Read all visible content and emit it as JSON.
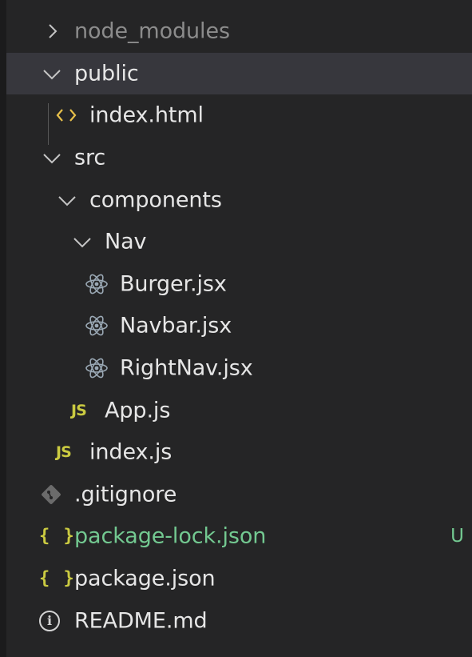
{
  "explorer": {
    "items": [
      {
        "label": "node_modules",
        "icon": "chevron-right-icon",
        "kind": "folder",
        "state": "collapsed"
      },
      {
        "label": "public",
        "icon": "chevron-down-icon",
        "kind": "folder",
        "state": "expanded",
        "selected": true
      },
      {
        "label": "index.html",
        "icon": "html-code-icon",
        "kind": "file"
      },
      {
        "label": "src",
        "icon": "chevron-down-icon",
        "kind": "folder",
        "state": "expanded"
      },
      {
        "label": "components",
        "icon": "chevron-down-icon",
        "kind": "folder",
        "state": "expanded"
      },
      {
        "label": "Nav",
        "icon": "chevron-down-icon",
        "kind": "folder",
        "state": "expanded"
      },
      {
        "label": "Burger.jsx",
        "icon": "react-icon",
        "kind": "file"
      },
      {
        "label": "Navbar.jsx",
        "icon": "react-icon",
        "kind": "file"
      },
      {
        "label": "RightNav.jsx",
        "icon": "react-icon",
        "kind": "file"
      },
      {
        "label": "App.js",
        "icon": "js-icon",
        "icon_text": "JS",
        "kind": "file"
      },
      {
        "label": "index.js",
        "icon": "js-icon",
        "icon_text": "JS",
        "kind": "file"
      },
      {
        "label": ".gitignore",
        "icon": "git-icon",
        "kind": "file"
      },
      {
        "label": "package-lock.json",
        "icon": "json-icon",
        "icon_text": "{ }",
        "kind": "file",
        "git_status": "U"
      },
      {
        "label": "package.json",
        "icon": "json-icon",
        "icon_text": "{ }",
        "kind": "file"
      },
      {
        "label": "README.md",
        "icon": "info-icon",
        "icon_text": "i",
        "kind": "file"
      }
    ]
  },
  "colors": {
    "background": "#252526",
    "selected_row": "#37373d",
    "text": "#e6e6e6",
    "dim_text": "#8c8c8c",
    "untracked_text": "#73c991",
    "js_icon": "#cbcb41",
    "json_icon": "#cbcb41",
    "html_icon": "#e8c04a",
    "react_icon": "#9aa8b4"
  }
}
